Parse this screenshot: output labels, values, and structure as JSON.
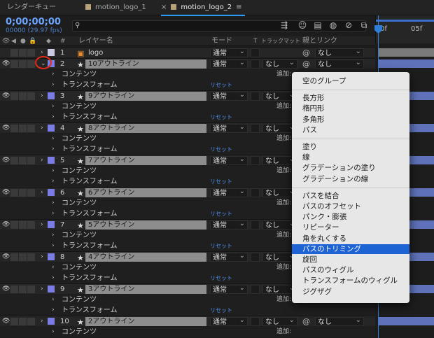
{
  "tabs": [
    {
      "label": "レンダーキュー",
      "active": false
    },
    {
      "label": "motion_logo_1",
      "active": false
    },
    {
      "label": "motion_logo_2",
      "active": true
    }
  ],
  "timecode": "0;00;00;00",
  "frame_info": "00000 (29.97 fps)",
  "ruler": {
    "start": "0f",
    "mark": "05f"
  },
  "columns": {
    "num": "#",
    "layer_name": "レイヤー名",
    "mode": "モード",
    "t": "T",
    "track_matte": "トラックマット",
    "parent": "親とリンク"
  },
  "labels": {
    "contents": "コンテンツ",
    "transform": "トランスフォーム",
    "reset": "リセット",
    "add": "追加:"
  },
  "layers": [
    {
      "num": "1",
      "name": "logo",
      "icon": "ai-file-icon",
      "mode": "通常",
      "matte": "",
      "parent": "なし",
      "color": "#c8c8e0"
    },
    {
      "num": "2",
      "name": "10アウトライン",
      "icon": "star-icon",
      "mode": "通常",
      "matte": "なし",
      "parent": "なし",
      "color": "#7c7ce6"
    },
    {
      "num": "3",
      "name": "9アウトライン",
      "icon": "star-icon",
      "mode": "通常",
      "matte": "なし",
      "parent": "",
      "color": "#7c7ce6"
    },
    {
      "num": "4",
      "name": "8アウトライン",
      "icon": "star-icon",
      "mode": "通常",
      "matte": "なし",
      "parent": "",
      "color": "#7c7ce6"
    },
    {
      "num": "5",
      "name": "7アウトライン",
      "icon": "star-icon",
      "mode": "通常",
      "matte": "なし",
      "parent": "",
      "color": "#7c7ce6"
    },
    {
      "num": "6",
      "name": "6アウトライン",
      "icon": "star-icon",
      "mode": "通常",
      "matte": "なし",
      "parent": "",
      "color": "#7c7ce6"
    },
    {
      "num": "7",
      "name": "5アウトライン",
      "icon": "star-icon",
      "mode": "通常",
      "matte": "なし",
      "parent": "",
      "color": "#7c7ce6"
    },
    {
      "num": "8",
      "name": "4アウトライン",
      "icon": "star-icon",
      "mode": "通常",
      "matte": "なし",
      "parent": "",
      "color": "#7c7ce6"
    },
    {
      "num": "9",
      "name": "3アウトライン",
      "icon": "star-icon",
      "mode": "通常",
      "matte": "なし",
      "parent": "",
      "color": "#7c7ce6"
    },
    {
      "num": "10",
      "name": "2アウトライン",
      "icon": "star-icon",
      "mode": "通常",
      "matte": "なし",
      "parent": "なし",
      "color": "#7c7ce6"
    }
  ],
  "menu": {
    "items": [
      {
        "label": "空のグループ",
        "selected": false
      },
      {
        "label": "長方形",
        "selected": false
      },
      {
        "label": "楕円形",
        "selected": false
      },
      {
        "label": "多角形",
        "selected": false
      },
      {
        "label": "パス",
        "selected": false
      },
      {
        "label": "塗り",
        "selected": false
      },
      {
        "label": "線",
        "selected": false
      },
      {
        "label": "グラデーションの塗り",
        "selected": false
      },
      {
        "label": "グラデーションの線",
        "selected": false
      },
      {
        "label": "パスを結合",
        "selected": false
      },
      {
        "label": "パスのオフセット",
        "selected": false
      },
      {
        "label": "パンク・膨張",
        "selected": false
      },
      {
        "label": "リピーター",
        "selected": false
      },
      {
        "label": "角を丸くする",
        "selected": false
      },
      {
        "label": "パスのトリミング",
        "selected": true
      },
      {
        "label": "旋回",
        "selected": false
      },
      {
        "label": "パスのウィグル",
        "selected": false
      },
      {
        "label": "トランスフォームのウィグル",
        "selected": false
      },
      {
        "label": "ジグザグ",
        "selected": false
      }
    ]
  },
  "colors": {
    "accent": "#1e63d4",
    "timecode": "#6aa5ff",
    "highlight_circle": "#e02a1a"
  }
}
